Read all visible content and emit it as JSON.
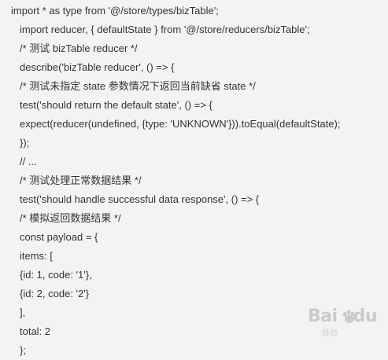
{
  "code": {
    "lines": [
      "import * as type from '@/store/types/bizTable';",
      "import reducer, { defaultState } from '@/store/reducers/bizTable';",
      "/* 测试 bizTable reducer */",
      "describe('bizTable reducer', () => {",
      "/* 测试未指定 state 参数情况下返回当前缺省 state */",
      "test('should return the default state', () => {",
      "expect(reducer(undefined, {type: 'UNKNOWN'})).toEqual(defaultState);",
      "});",
      "// ...",
      "/* 测试处理正常数据结果 */",
      "test('should handle successful data response', () => {",
      "/* 模拟返回数据结果 */",
      "const payload = {",
      "items: [",
      "{id: 1, code: '1'},",
      "{id: 2, code: '2'}",
      "],",
      "total: 2",
      "};"
    ]
  },
  "watermark": {
    "brand": "Bai",
    "brand_suffix": "du",
    "subtext": "经验"
  },
  "colors": {
    "background": "#f3f3f3",
    "text": "#333333",
    "watermark": "#8a8a8a"
  }
}
